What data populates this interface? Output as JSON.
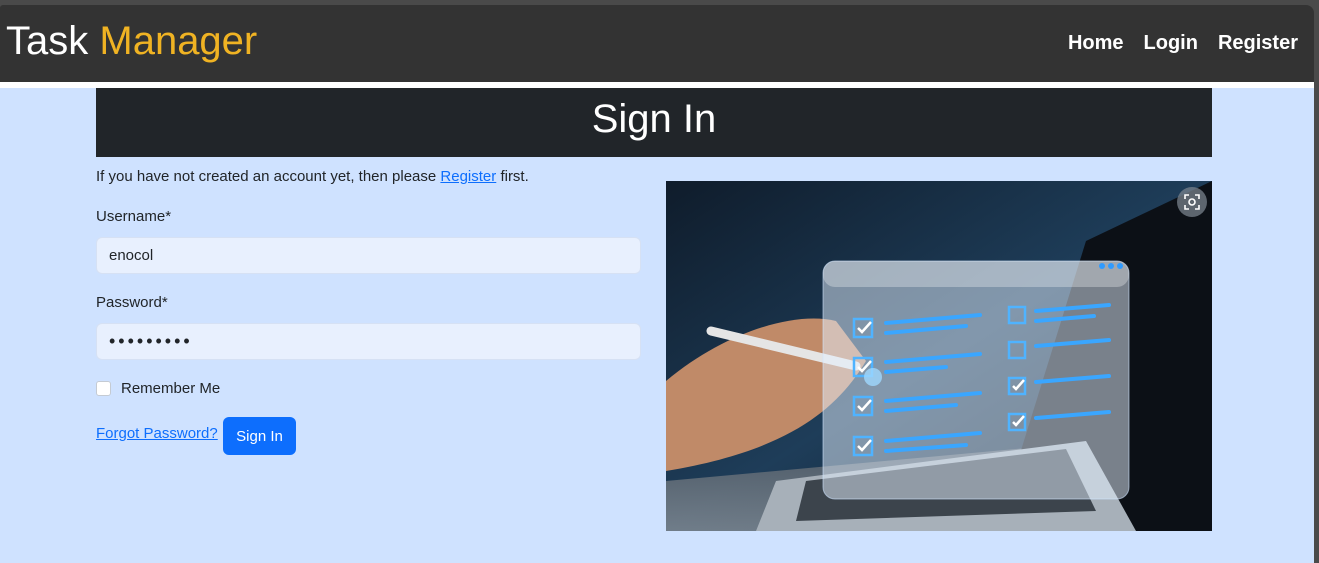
{
  "brand": {
    "part1": "Task",
    "part2": "Manager"
  },
  "nav": {
    "home": "Home",
    "login": "Login",
    "register": "Register"
  },
  "signin": {
    "heading": "Sign In",
    "intro_before": "If you have not created an account yet, then please",
    "intro_link": "Register",
    "intro_after": "first.",
    "username_label": "Username*",
    "username_value": "enocol",
    "password_label": "Password*",
    "password_masked": "•••••••••",
    "remember_label": "Remember Me",
    "forgot_link": "Forgot Password?",
    "submit_label": "Sign In"
  },
  "image": {
    "icon": "visual-search-icon"
  },
  "colors": {
    "navbar": "#333333",
    "brand_accent": "#f0b323",
    "page_bg": "#cfe2ff",
    "header_bg": "#212529",
    "primary": "#0d6efd",
    "input_bg": "#e8f0fe"
  }
}
